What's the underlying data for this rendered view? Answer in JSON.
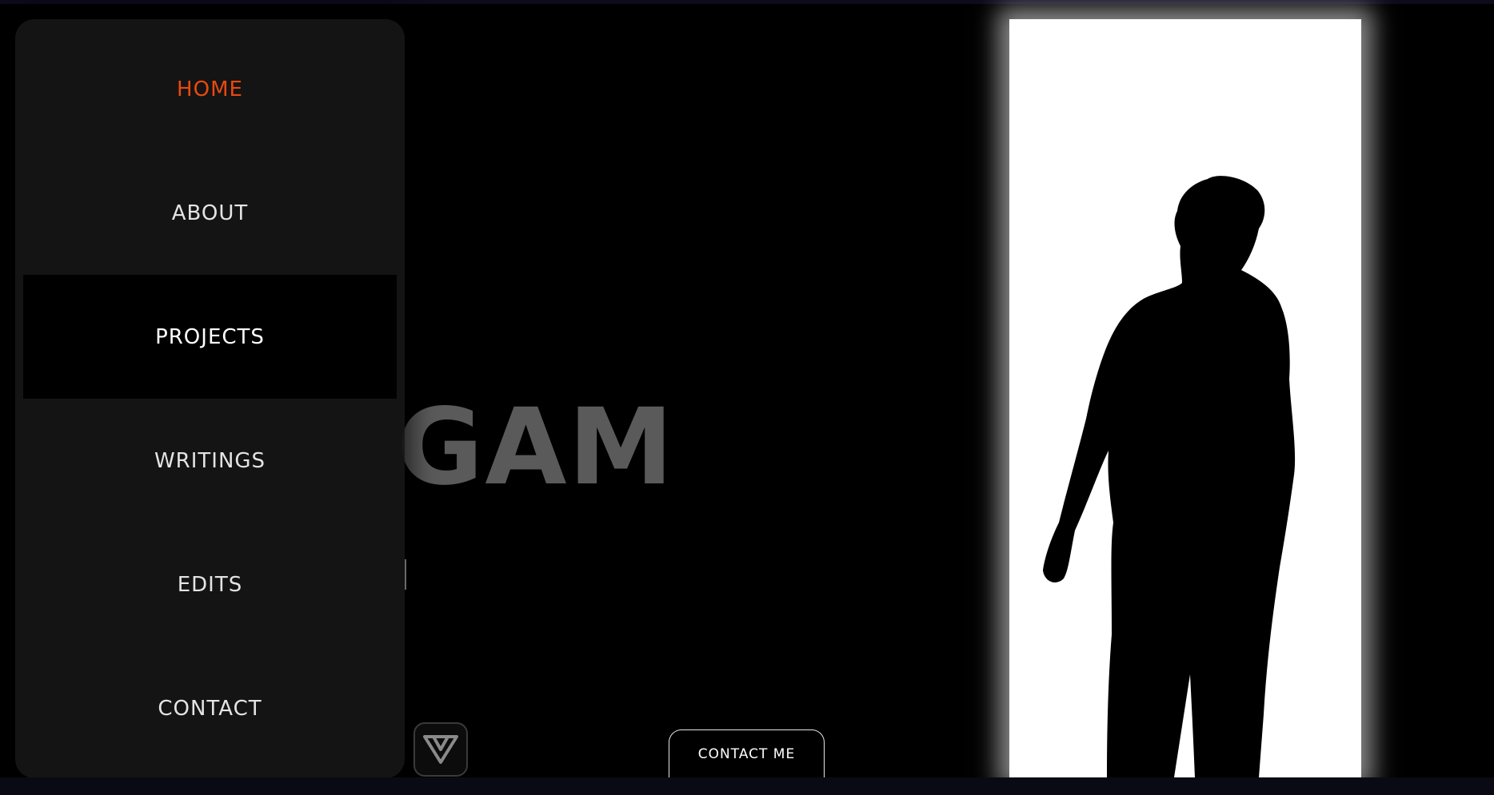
{
  "hero": {
    "title_visible": "GAM",
    "subtitle_visible": ""
  },
  "menu": {
    "items": [
      {
        "label": "HOME",
        "state": "active"
      },
      {
        "label": "ABOUT",
        "state": "normal"
      },
      {
        "label": "PROJECTS",
        "state": "hover"
      },
      {
        "label": "WRITINGS",
        "state": "normal"
      },
      {
        "label": "EDITS",
        "state": "normal"
      },
      {
        "label": "CONTACT",
        "state": "normal"
      }
    ]
  },
  "cta": {
    "contact_label": "CONTACT ME"
  },
  "icons": {
    "logo": "v-shield-logo-icon"
  },
  "colors": {
    "accent": "#e8490f",
    "menu_background": "#161616",
    "highlight_background": "#000000",
    "page_background": "#000000"
  }
}
